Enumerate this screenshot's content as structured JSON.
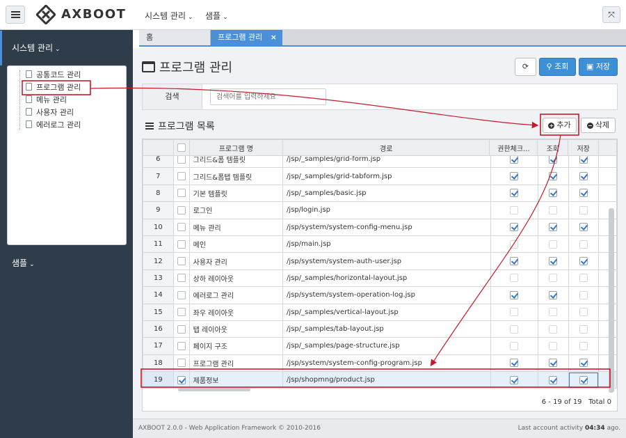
{
  "header": {
    "logo_text": "AXBOOT",
    "menus": [
      "시스템 관리",
      "샘플"
    ]
  },
  "sidebar": {
    "sections": [
      "시스템 관리",
      "샘플"
    ],
    "tree_items": [
      "공통코드 관리",
      "프로그램 관리",
      "메뉴 관리",
      "사용자 관리",
      "에러로그 관리"
    ]
  },
  "tabs": {
    "home": "홈",
    "active": "프로그램 관리",
    "close": "×"
  },
  "page": {
    "title": "프로그램 관리",
    "search_btn": "조회",
    "save_btn": "저장",
    "search_label": "검색",
    "search_placeholder": "검색어를 입력하세요",
    "list_title": "프로그램 목록",
    "add_btn": "추가",
    "del_btn": "삭제"
  },
  "grid": {
    "columns": [
      "",
      "",
      "프로그램 명",
      "경로",
      "권한체크...",
      "조회",
      "저장"
    ],
    "rows": [
      {
        "no": "6",
        "name": "그리드&폼 템플릿",
        "path": "/jsp/_samples/grid-form.jsp",
        "sel": false,
        "auth": true,
        "view": true,
        "save": true
      },
      {
        "no": "7",
        "name": "그리드&폼탭 템플릿",
        "path": "/jsp/_samples/grid-tabform.jsp",
        "sel": false,
        "auth": true,
        "view": true,
        "save": true
      },
      {
        "no": "8",
        "name": "기본 템플릿",
        "path": "/jsp/_samples/basic.jsp",
        "sel": false,
        "auth": true,
        "view": true,
        "save": true
      },
      {
        "no": "9",
        "name": "로그인",
        "path": "/jsp/login.jsp",
        "sel": false,
        "auth": false,
        "view": false,
        "save": false
      },
      {
        "no": "10",
        "name": "메뉴 관리",
        "path": "/jsp/system/system-config-menu.jsp",
        "sel": false,
        "auth": true,
        "view": true,
        "save": true
      },
      {
        "no": "11",
        "name": "메인",
        "path": "/jsp/main.jsp",
        "sel": false,
        "auth": false,
        "view": false,
        "save": false
      },
      {
        "no": "12",
        "name": "사용자 관리",
        "path": "/jsp/system/system-auth-user.jsp",
        "sel": false,
        "auth": true,
        "view": true,
        "save": true
      },
      {
        "no": "13",
        "name": "상하 레이아웃",
        "path": "/jsp/_samples/horizontal-layout.jsp",
        "sel": false,
        "auth": false,
        "view": false,
        "save": false
      },
      {
        "no": "14",
        "name": "에러로그 관리",
        "path": "/jsp/system/system-operation-log.jsp",
        "sel": false,
        "auth": true,
        "view": true,
        "save": false
      },
      {
        "no": "15",
        "name": "좌우 레이아웃",
        "path": "/jsp/_samples/vertical-layout.jsp",
        "sel": false,
        "auth": false,
        "view": false,
        "save": false
      },
      {
        "no": "16",
        "name": "탭 레이아웃",
        "path": "/jsp/_samples/tab-layout.jsp",
        "sel": false,
        "auth": false,
        "view": false,
        "save": false
      },
      {
        "no": "17",
        "name": "페이지 구조",
        "path": "/jsp/_samples/page-structure.jsp",
        "sel": false,
        "auth": false,
        "view": false,
        "save": false
      },
      {
        "no": "18",
        "name": "프로그램 관리",
        "path": "/jsp/system/system-config-program.jsp",
        "sel": false,
        "auth": true,
        "view": true,
        "save": true
      },
      {
        "no": "19",
        "name": "제품정보",
        "path": "/jsp/shopmng/product.jsp",
        "sel": true,
        "auth": true,
        "view": true,
        "save": true
      }
    ],
    "pager": "6 - 19 of 19",
    "total": "Total 0"
  },
  "footer": {
    "left": "AXBOOT 2.0.0 - Web Application Framework © 2010-2016",
    "right_prefix": "Last account activity",
    "right_time": "04:34",
    "right_suffix": "ago."
  },
  "colors": {
    "accent": "#3d8fd6",
    "sidebar": "#2f3c4a",
    "annotation": "#c8192a"
  },
  "icons": [
    "menu-icon",
    "axboot-logo-icon",
    "chevron-down-icon",
    "fullscreen-icon",
    "file-icon",
    "window-icon",
    "refresh-icon",
    "search-icon",
    "save-icon",
    "list-icon",
    "plus-circle-icon",
    "minus-circle-icon",
    "close-icon",
    "check-icon"
  ]
}
